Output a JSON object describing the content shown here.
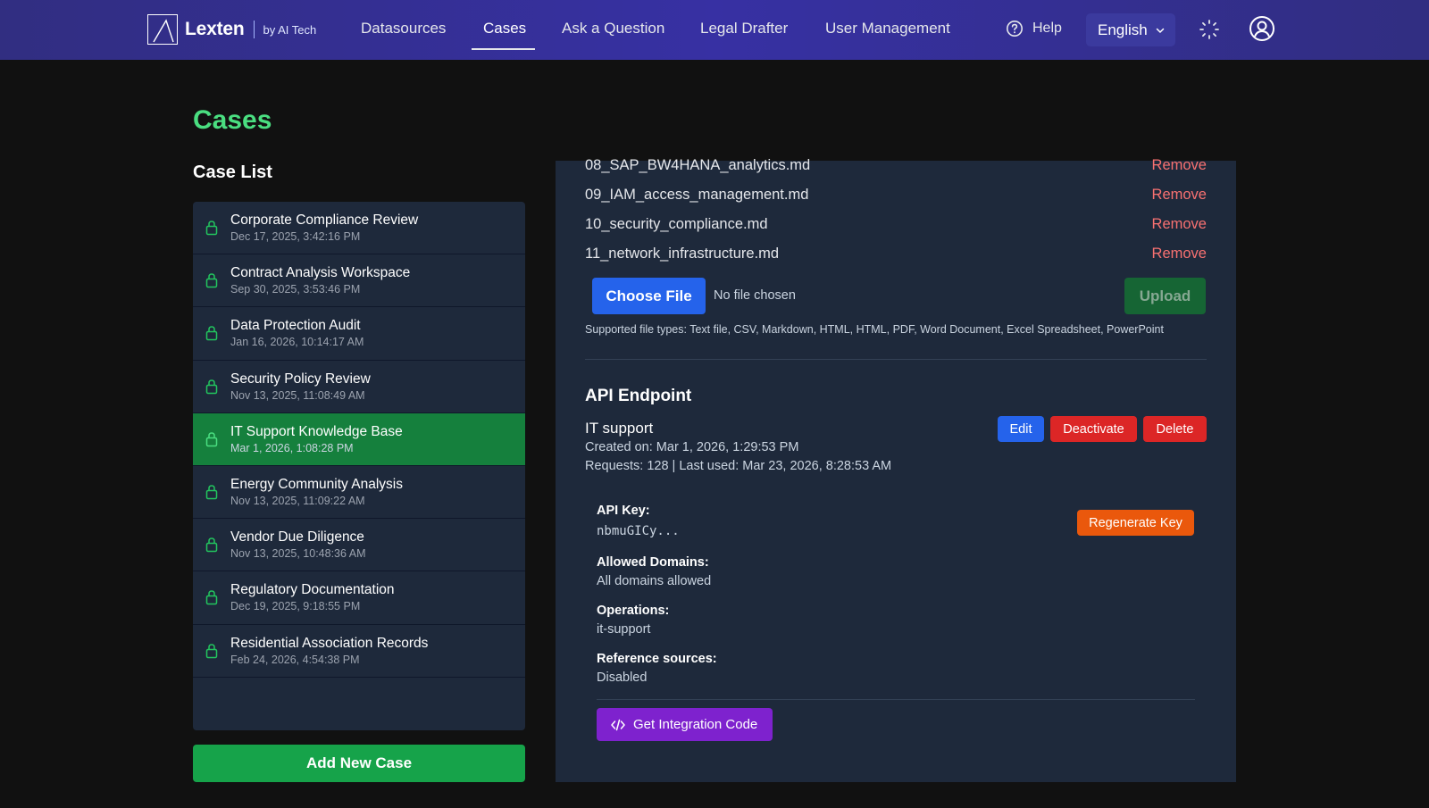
{
  "nav": {
    "brand": "Lexten",
    "brand_by": "by AI Tech",
    "links": [
      "Datasources",
      "Cases",
      "Ask a Question",
      "Legal Drafter",
      "User Management"
    ],
    "active": "Cases",
    "help": "Help",
    "language": "English"
  },
  "page": {
    "title": "Cases",
    "case_list_title": "Case List",
    "add_button": "Add New Case"
  },
  "cases": [
    {
      "name": "Corporate Compliance Review",
      "date": "Dec 17, 2025, 3:42:16 PM"
    },
    {
      "name": "Contract Analysis Workspace",
      "date": "Sep 30, 2025, 3:53:46 PM"
    },
    {
      "name": "Data Protection Audit",
      "date": "Jan 16, 2026, 10:14:17 AM"
    },
    {
      "name": "Security Policy Review",
      "date": "Nov 13, 2025, 11:08:49 AM"
    },
    {
      "name": "IT Support Knowledge Base",
      "date": "Mar 1, 2026, 1:08:28 PM",
      "selected": true
    },
    {
      "name": "Energy Community Analysis",
      "date": "Nov 13, 2025, 11:09:22 AM"
    },
    {
      "name": "Vendor Due Diligence",
      "date": "Nov 13, 2025, 10:48:36 AM"
    },
    {
      "name": "Regulatory Documentation",
      "date": "Dec 19, 2025, 9:18:55 PM"
    },
    {
      "name": "Residential Association Records",
      "date": "Feb 24, 2026, 4:54:38 PM"
    }
  ],
  "files": [
    {
      "name": "08_SAP_BW4HANA_analytics.md",
      "action": "Remove"
    },
    {
      "name": "09_IAM_access_management.md",
      "action": "Remove"
    },
    {
      "name": "10_security_compliance.md",
      "action": "Remove"
    },
    {
      "name": "11_network_infrastructure.md",
      "action": "Remove"
    }
  ],
  "upload": {
    "choose_label": "Choose File",
    "no_file": "No file chosen",
    "upload_label": "Upload",
    "supported": "Supported file types: Text file, CSV, Markdown, HTML, HTML, PDF, Word Document, Excel Spreadsheet, PowerPoint"
  },
  "api": {
    "section_title": "API Endpoint",
    "name": "IT support",
    "created": "Created on: Mar 1, 2026, 1:29:53 PM",
    "requests": "Requests: 128 | Last used: Mar 23, 2026, 8:28:53 AM",
    "edit": "Edit",
    "deactivate": "Deactivate",
    "delete": "Delete",
    "key_label": "API Key:",
    "key_value": "nbmuGICy...",
    "regen": "Regenerate Key",
    "domains_label": "Allowed Domains:",
    "domains_value": "All domains allowed",
    "ops_label": "Operations:",
    "ops_value": "it-support",
    "refs_label": "Reference sources:",
    "refs_value": "Disabled",
    "integration": "Get Integration Code"
  },
  "colors": {
    "accent_green": "#4ade80",
    "nav_bg": "#3730a3",
    "remove_red": "#f87171"
  }
}
